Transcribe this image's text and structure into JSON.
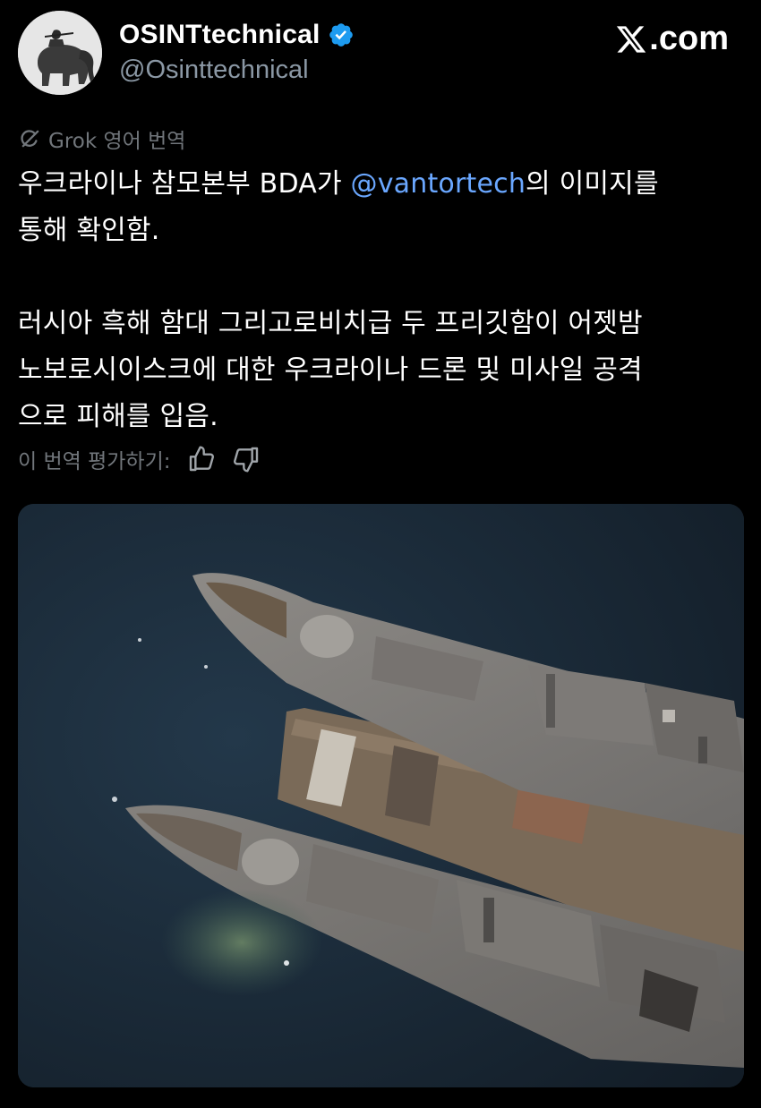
{
  "header": {
    "display_name": "OSINTtechnical",
    "handle": "@Osinttechnical",
    "brand": ".com",
    "avatar_icon": "soldier-on-elephant-avatar",
    "verified_color": "#1d9bf0"
  },
  "translation": {
    "label": "Grok 영어 번역"
  },
  "body": {
    "line1_before": "우크라이나 참모본부 BDA가 ",
    "mention": "@vantortech",
    "line1_after": "의 이미지를",
    "line2": "통해 확인함.",
    "para2_line1": "러시아 흑해 함대 그리고로비치급 두 프리깃함이 어젯밤",
    "para2_line2": "노보로시이스크에 대한 우크라이나 드론 및 미사일 공격",
    "para2_line3": "으로 피해를 입음.",
    "mention_color": "#6aa7ff"
  },
  "rate": {
    "label": "이 번역 평가하기:"
  },
  "media": {
    "description_icon": "satellite-image-two-frigates"
  }
}
